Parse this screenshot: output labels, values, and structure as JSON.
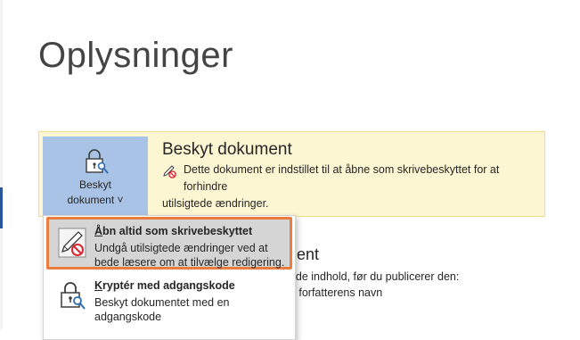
{
  "page": {
    "title": "Oplysninger"
  },
  "protect": {
    "button_line1": "Beskyt",
    "button_line2": "dokument",
    "button_chevron": "˅",
    "title": "Beskyt dokument",
    "description_line1": "Dette dokument er indstillet til at åbne som skrivebeskyttet for at forhindre",
    "description_line2": "utilsigtede ændringer."
  },
  "background": {
    "heading": "ment",
    "line1": "ende indhold, før du publicerer den:",
    "line2": "og forfatterens navn"
  },
  "menu": {
    "items": [
      {
        "accel": "Å",
        "title_rest": "bn altid som skrivebeskyttet",
        "desc_line1": "Undgå utilsigtede ændringer ved at",
        "desc_line2": "bede læsere om at tilvælge redigering.",
        "icon": "pencil-no-edit-icon"
      },
      {
        "accel": "K",
        "title_rest": "ryptér med adgangskode",
        "desc_line1": "Beskyt dokumentet med en",
        "desc_line2": "adgangskode",
        "icon": "lock-key-icon"
      }
    ]
  },
  "colors": {
    "panel_bg": "#fdf6d3",
    "button_bg": "#a9c3e6",
    "highlight_border": "#e97d3f",
    "highlight_bg": "#d5d5d5",
    "no_sign": "#d9262e"
  }
}
